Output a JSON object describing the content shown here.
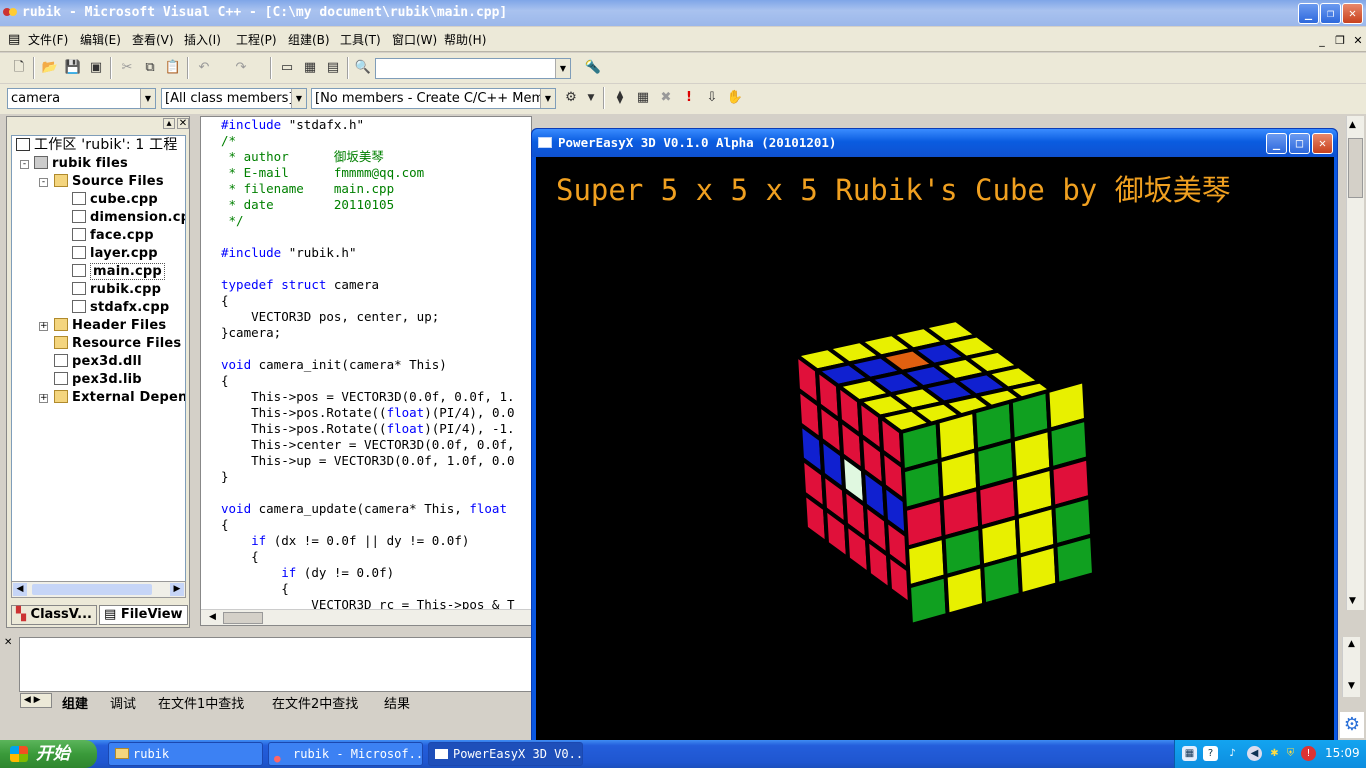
{
  "app": {
    "title": "rubik - Microsoft Visual C++ - [C:\\my document\\rubik\\main.cpp]"
  },
  "menu": [
    "文件(F)",
    "编辑(E)",
    "查看(V)",
    "插入(I)",
    "工程(P)",
    "组建(B)",
    "工具(T)",
    "窗口(W)",
    "帮助(H)"
  ],
  "toolbar2": {
    "class_combo": "camera",
    "filter_combo": "[All class members]",
    "members_combo": "[No members - Create C/C++ Memb"
  },
  "workspace": {
    "root": "工作区 'rubik': 1 工程",
    "project": "rubik files",
    "source_folder": "Source Files",
    "source_files": [
      "cube.cpp",
      "dimension.cpp",
      "face.cpp",
      "layer.cpp",
      "main.cpp",
      "rubik.cpp",
      "stdafx.cpp"
    ],
    "header_folder": "Header Files",
    "resource_folder": "Resource Files",
    "libs": [
      "pex3d.dll",
      "pex3d.lib"
    ],
    "external": "External Depend",
    "tabs": [
      "ClassV...",
      "FileView"
    ]
  },
  "code": [
    {
      "t": "#include \"stdafx.h\"",
      "c": ""
    },
    {
      "t": "/*",
      "c": "cm"
    },
    {
      "t": " * author      御坂美琴",
      "c": "cm"
    },
    {
      "t": " * E-mail      fmmmm@qq.com",
      "c": "cm"
    },
    {
      "t": " * filename    main.cpp",
      "c": "cm"
    },
    {
      "t": " * date        20110105",
      "c": "cm"
    },
    {
      "t": " */",
      "c": "cm"
    },
    {
      "t": "",
      "c": ""
    },
    {
      "t": "#include \"rubik.h\"",
      "c": ""
    },
    {
      "t": "",
      "c": ""
    },
    {
      "t": "typedef struct camera",
      "c": ""
    },
    {
      "t": "{",
      "c": ""
    },
    {
      "t": "    VECTOR3D pos, center, up;",
      "c": ""
    },
    {
      "t": "}camera;",
      "c": ""
    },
    {
      "t": "",
      "c": ""
    },
    {
      "t": "void camera_init(camera* This)",
      "c": ""
    },
    {
      "t": "{",
      "c": ""
    },
    {
      "t": "    This->pos = VECTOR3D(0.0f, 0.0f, 1.",
      "c": ""
    },
    {
      "t": "    This->pos.Rotate((float)(PI/4), 0.0",
      "c": ""
    },
    {
      "t": "    This->pos.Rotate((float)(PI/4), -1.",
      "c": ""
    },
    {
      "t": "    This->center = VECTOR3D(0.0f, 0.0f,",
      "c": ""
    },
    {
      "t": "    This->up = VECTOR3D(0.0f, 1.0f, 0.0",
      "c": ""
    },
    {
      "t": "}",
      "c": ""
    },
    {
      "t": "",
      "c": ""
    },
    {
      "t": "void camera_update(camera* This, float",
      "c": ""
    },
    {
      "t": "{",
      "c": ""
    },
    {
      "t": "    if (dx != 0.0f || dy != 0.0f)",
      "c": ""
    },
    {
      "t": "    {",
      "c": ""
    },
    {
      "t": "        if (dy != 0.0f)",
      "c": ""
    },
    {
      "t": "        {",
      "c": ""
    },
    {
      "t": "            VECTOR3D rc = This->pos & T",
      "c": ""
    }
  ],
  "output_tabs": [
    "组建",
    "调试",
    "在文件1中查找",
    "在文件2中查找",
    "结果"
  ],
  "app3d": {
    "title": "PowerEasyX 3D V0.1.0 Alpha (20101201)",
    "heading": "Super 5 x 5 x 5 Rubik's Cube by 御坂美琴"
  },
  "taskbar": {
    "start": "开始",
    "tasks": [
      "rubik",
      "rubik - Microsof...",
      "PowerEasyX 3D V0..."
    ],
    "clock": "15:09"
  },
  "colors": {
    "title_blue": "#0a58e2",
    "heading_orange": "#f0a020",
    "keyword_blue": "#0000ff",
    "comment_green": "#008000"
  },
  "cube": {
    "top": [
      [
        "yellow",
        "yellow",
        "yellow",
        "yellow",
        "yellow"
      ],
      [
        "blue",
        "blue",
        "orange",
        "blue",
        "yellow"
      ],
      [
        "yellow",
        "blue",
        "blue",
        "yellow",
        "yellow"
      ],
      [
        "yellow",
        "yellow",
        "blue",
        "blue",
        "yellow"
      ],
      [
        "yellow",
        "yellow",
        "yellow",
        "yellow",
        "yellow"
      ]
    ],
    "left": [
      [
        "red",
        "red",
        "red",
        "red",
        "red"
      ],
      [
        "red",
        "red",
        "red",
        "red",
        "red"
      ],
      [
        "blue",
        "blue",
        "white",
        "blue",
        "blue"
      ],
      [
        "red",
        "red",
        "red",
        "red",
        "red"
      ],
      [
        "red",
        "red",
        "red",
        "red",
        "red"
      ]
    ],
    "right": [
      [
        "green",
        "yellow",
        "green",
        "green",
        "yellow"
      ],
      [
        "green",
        "yellow",
        "green",
        "yellow",
        "green"
      ],
      [
        "red",
        "red",
        "red",
        "yellow",
        "red"
      ],
      [
        "yellow",
        "green",
        "yellow",
        "yellow",
        "green"
      ],
      [
        "green",
        "yellow",
        "green",
        "yellow",
        "green"
      ]
    ]
  }
}
